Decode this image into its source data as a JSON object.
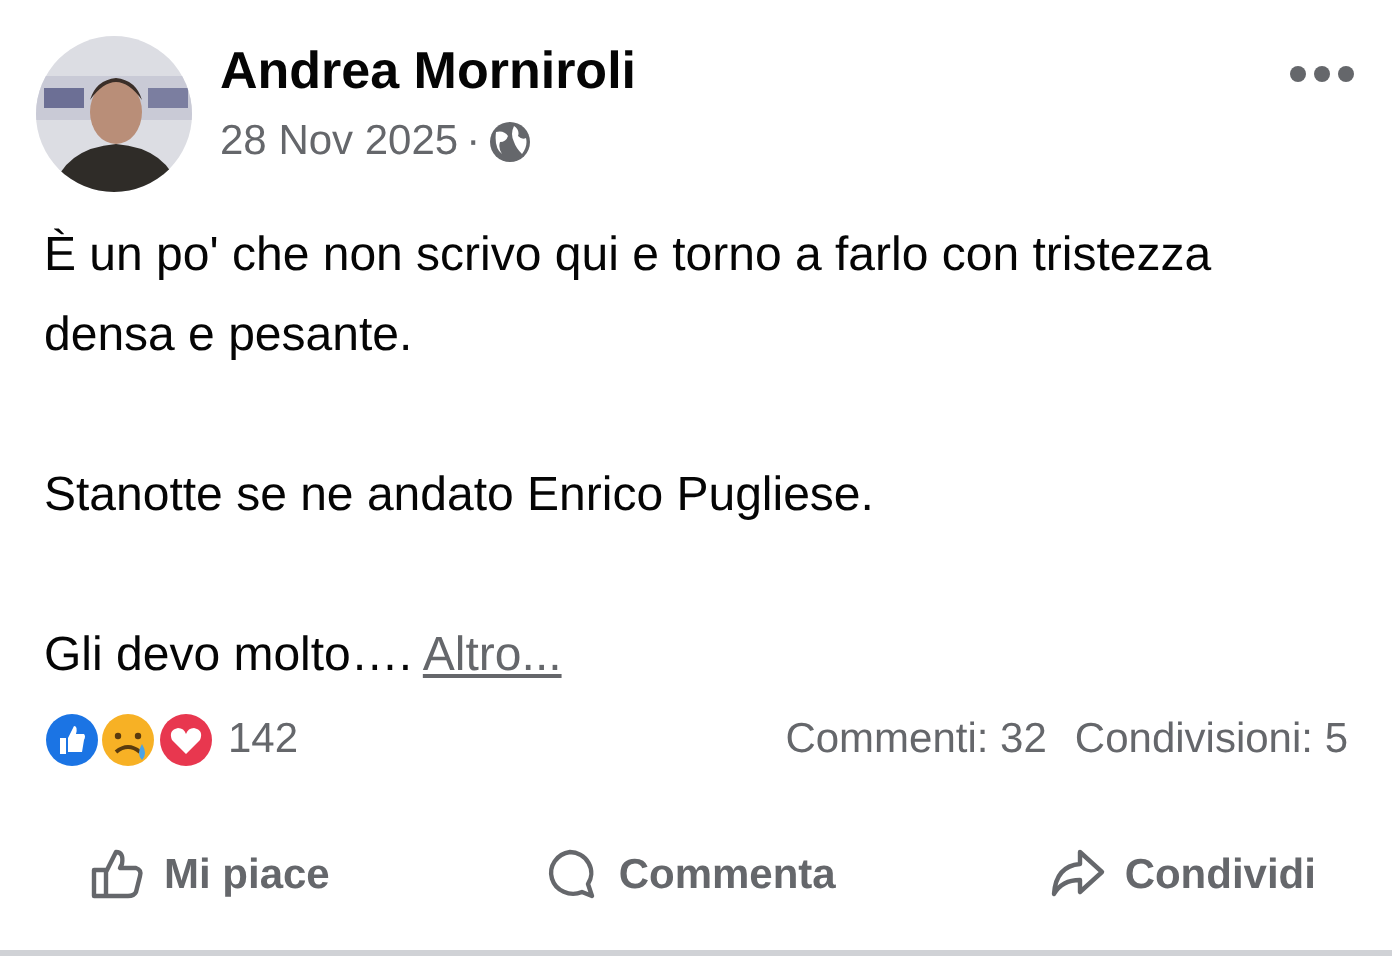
{
  "post": {
    "author": "Andrea Morniroli",
    "date": "28 Nov 2025",
    "separator": "·",
    "paragraphs": [
      "È un po' che non scrivo qui e torno a farlo con tristezza densa e pesante.",
      "Stanotte se ne andato Enrico Pugliese.",
      "Gli devo molto…."
    ],
    "more_link": "Altro...",
    "reactions_count": "142",
    "comments": "Commenti: 32",
    "shares": "Condivisioni: 5",
    "actions": [
      {
        "kind": "like",
        "label": "Mi piace"
      },
      {
        "kind": "comment",
        "label": "Commenta"
      },
      {
        "kind": "share",
        "label": "Condividi"
      }
    ]
  }
}
